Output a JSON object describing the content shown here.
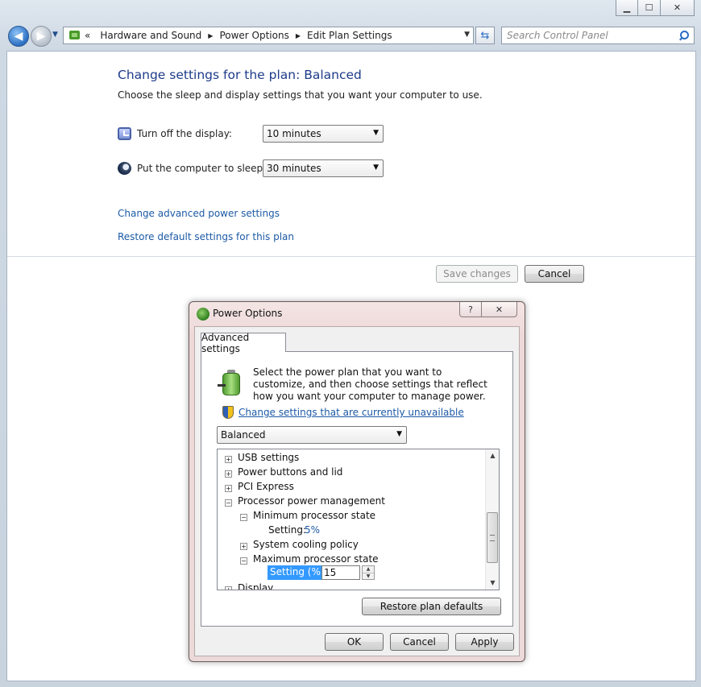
{
  "window": {
    "caption_buttons": {
      "minimize": "▁",
      "maximize": "☐",
      "close": "✕"
    }
  },
  "nav": {
    "back": "◀",
    "forward": "▶",
    "breadcrumb": [
      "Hardware and Sound",
      "Power Options",
      "Edit Plan Settings"
    ],
    "crumb_prefix": "«",
    "search_placeholder": "Search Control Panel"
  },
  "main": {
    "title": "Change settings for the plan: Balanced",
    "subtitle": "Choose the sleep and display settings that you want your computer to use.",
    "display_label": "Turn off the display:",
    "display_value": "10 minutes",
    "sleep_label": "Put the computer to sleep:",
    "sleep_value": "30 minutes",
    "link_advanced": "Change advanced power settings",
    "link_restore": "Restore default settings for this plan",
    "save_label": "Save changes",
    "cancel_label": "Cancel"
  },
  "dialog": {
    "title": "Power Options",
    "help": "?",
    "close": "✕",
    "tab": "Advanced settings",
    "intro": "Select the power plan that you want to customize, and then choose settings that reflect how you want your computer to manage power.",
    "unavailable_link": "Change settings that are currently unavailable",
    "plan_value": "Balanced",
    "tree": {
      "usb": "USB settings",
      "power_buttons": "Power buttons and lid",
      "pci": "PCI Express",
      "processor": "Processor power management",
      "min_state": "Minimum processor state",
      "min_setting_label": "Setting:",
      "min_setting_value": "5%",
      "cooling": "System cooling policy",
      "max_state": "Maximum processor state",
      "max_setting_label": "Setting (%):",
      "max_setting_value": "15",
      "display": "Display"
    },
    "restore_label": "Restore plan defaults",
    "ok_label": "OK",
    "cancel_label": "Cancel",
    "apply_label": "Apply"
  },
  "glyphs": {
    "plus": "+",
    "minus": "−",
    "dropdown": "▼",
    "up": "▲",
    "down": "▼",
    "chevron": "▶",
    "refresh": "⇆"
  }
}
